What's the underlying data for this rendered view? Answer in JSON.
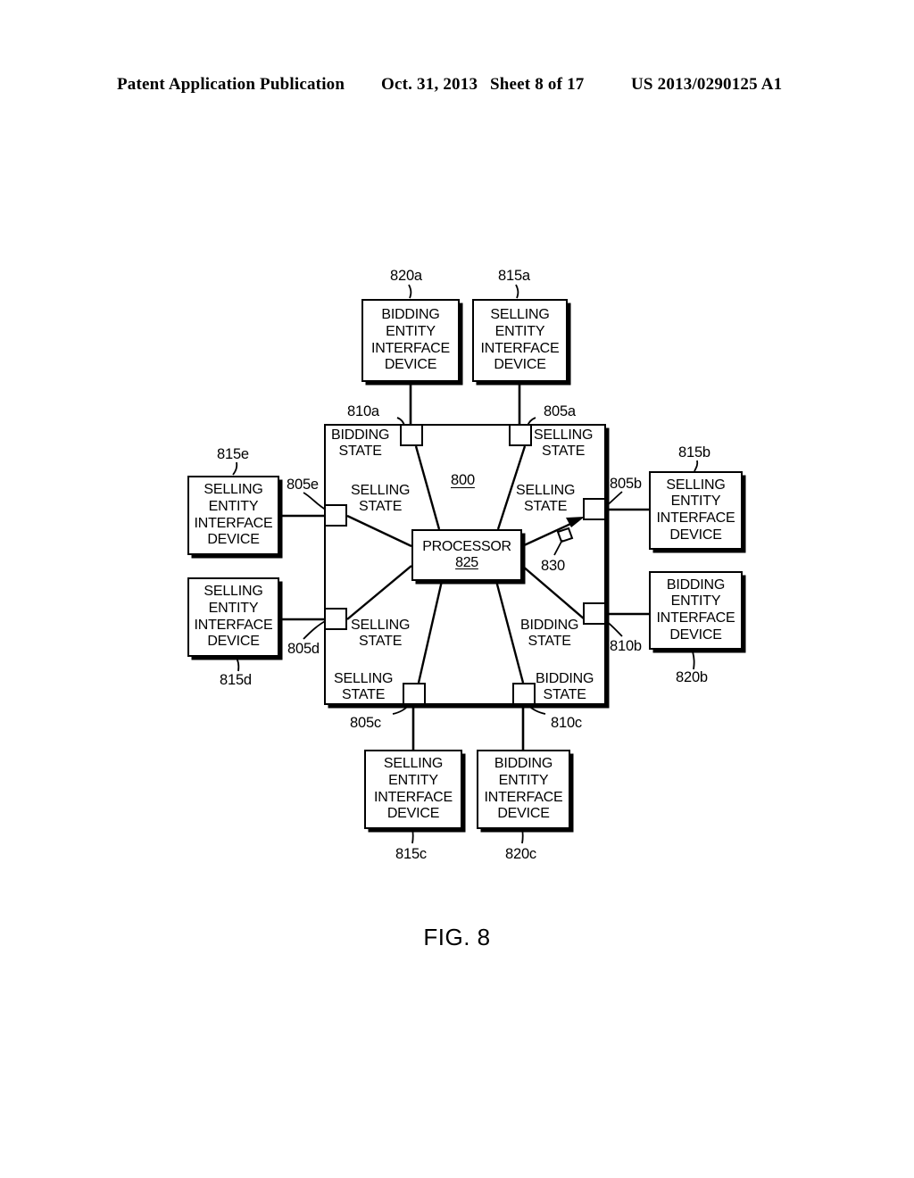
{
  "header": {
    "publication": "Patent Application Publication",
    "date": "Oct. 31, 2013",
    "sheet": "Sheet 8 of 17",
    "patent_number": "US 2013/0290125 A1"
  },
  "figure": {
    "caption": "FIG. 8",
    "system_ref": "800",
    "processor": {
      "label": "PROCESSOR",
      "ref": "825"
    },
    "interface_devices": [
      {
        "id": "820a",
        "position": "top-left",
        "line1": "BIDDING",
        "line2": "ENTITY",
        "line3": "INTERFACE",
        "line4": "DEVICE",
        "ref": "820a"
      },
      {
        "id": "815a",
        "position": "top-right",
        "line1": "SELLING",
        "line2": "ENTITY",
        "line3": "INTERFACE",
        "line4": "DEVICE",
        "ref": "815a"
      },
      {
        "id": "815e",
        "position": "left-upper",
        "line1": "SELLING",
        "line2": "ENTITY",
        "line3": "INTERFACE",
        "line4": "DEVICE",
        "ref": "815e"
      },
      {
        "id": "815d",
        "position": "left-lower",
        "line1": "SELLING",
        "line2": "ENTITY",
        "line3": "INTERFACE",
        "line4": "DEVICE",
        "ref": "815d"
      },
      {
        "id": "815b",
        "position": "right-upper",
        "line1": "SELLING",
        "line2": "ENTITY",
        "line3": "INTERFACE",
        "line4": "DEVICE",
        "ref": "815b"
      },
      {
        "id": "820b",
        "position": "right-lower",
        "line1": "BIDDING",
        "line2": "ENTITY",
        "line3": "INTERFACE",
        "line4": "DEVICE",
        "ref": "820b"
      },
      {
        "id": "815c",
        "position": "bottom-left",
        "line1": "SELLING",
        "line2": "ENTITY",
        "line3": "INTERFACE",
        "line4": "DEVICE",
        "ref": "815c"
      },
      {
        "id": "820c",
        "position": "bottom-right",
        "line1": "BIDDING",
        "line2": "ENTITY",
        "line3": "INTERFACE",
        "line4": "DEVICE",
        "ref": "820c"
      }
    ],
    "states": [
      {
        "id": "810a",
        "line1": "BIDDING",
        "line2": "STATE",
        "port_ref": "810a"
      },
      {
        "id": "805a",
        "line1": "SELLING",
        "line2": "STATE",
        "port_ref": "805a"
      },
      {
        "id": "805e",
        "line1": "SELLING",
        "line2": "STATE",
        "port_ref": "805e"
      },
      {
        "id": "805b",
        "line1": "SELLING",
        "line2": "STATE",
        "port_ref": "805b"
      },
      {
        "id": "805d",
        "line1": "SELLING",
        "line2": "STATE",
        "port_ref": "805d"
      },
      {
        "id": "810b",
        "line1": "BIDDING",
        "line2": "STATE",
        "port_ref": "810b"
      },
      {
        "id": "805c",
        "line1": "SELLING",
        "line2": "STATE",
        "port_ref": "805c"
      },
      {
        "id": "810c",
        "line1": "BIDDING",
        "line2": "STATE",
        "port_ref": "810c"
      }
    ],
    "connection_marker": {
      "ref": "830"
    }
  },
  "colors": {
    "ink": "#000000",
    "paper": "#ffffff"
  }
}
